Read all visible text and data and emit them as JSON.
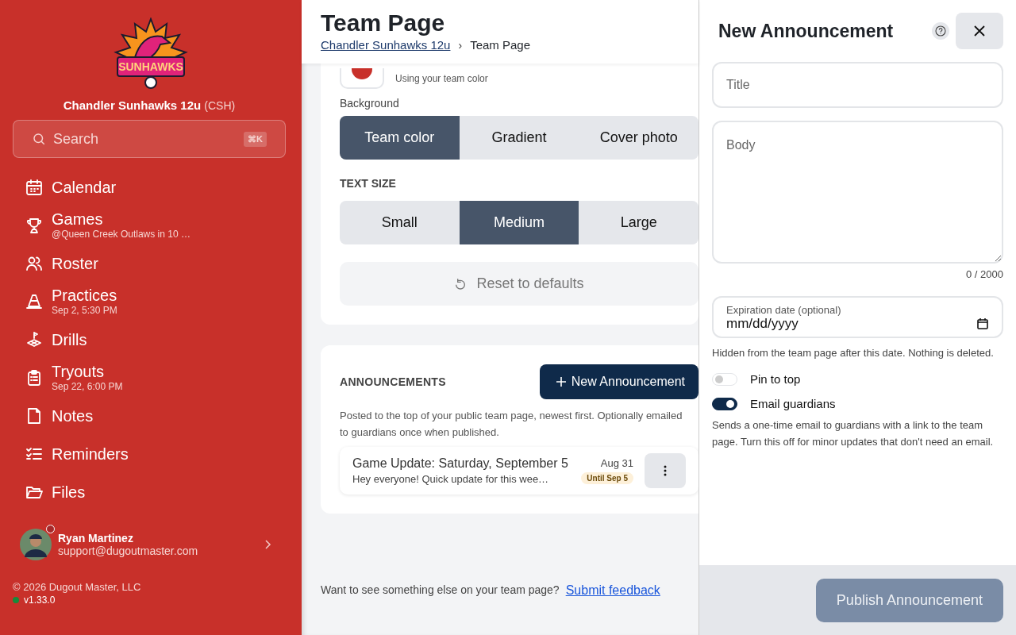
{
  "sidebar": {
    "logo": {
      "wordmark": "SUNHAWKS"
    },
    "team_name": "Chandler Sunhawks 12u",
    "team_code": "(CSH)",
    "search": {
      "placeholder": "Search",
      "shortcut": "⌘K"
    },
    "items": [
      {
        "label": "Calendar"
      },
      {
        "label": "Games",
        "sub": "@Queen Creek Outlaws in 10 …"
      },
      {
        "label": "Roster"
      },
      {
        "label": "Practices",
        "sub": "Sep 2, 5:30 PM"
      },
      {
        "label": "Drills"
      },
      {
        "label": "Tryouts",
        "sub": "Sep 22, 6:00 PM"
      },
      {
        "label": "Notes"
      },
      {
        "label": "Reminders"
      },
      {
        "label": "Files"
      }
    ],
    "user": {
      "name": "Ryan Martinez",
      "email": "support@dugoutmaster.com"
    },
    "copyright": "© 2026 Dugout Master, LLC",
    "version": "v1.33.0"
  },
  "header": {
    "title": "Team Page",
    "breadcrumb_separator": "›",
    "breadcrumb": [
      {
        "label": "Chandler Sunhawks 12u",
        "link": true
      },
      {
        "label": "Team Page",
        "link": false
      }
    ]
  },
  "appearance": {
    "swatch_text": "Using your team color",
    "background_label": "Background",
    "background_options": [
      {
        "label": "Team color",
        "selected": true
      },
      {
        "label": "Gradient",
        "selected": false
      },
      {
        "label": "Cover photo",
        "selected": false
      }
    ],
    "text_size_label": "TEXT SIZE",
    "text_size_options": [
      {
        "label": "Small",
        "selected": false
      },
      {
        "label": "Medium",
        "selected": true
      },
      {
        "label": "Large",
        "selected": false
      }
    ],
    "reset_button": "Reset to defaults"
  },
  "announcements": {
    "heading": "ANNOUNCEMENTS",
    "new_button": "New Announcement",
    "description": "Posted to the top of your public team page, newest first. Optionally emailed to guardians once when published.",
    "items": [
      {
        "title": "Game Update: Saturday, September 5",
        "excerpt": "Hey everyone! Quick update for this wee…",
        "date": "Aug 31",
        "badge": "Until Sep 5"
      }
    ]
  },
  "feedback": {
    "text": "Want to see something else on your team page?",
    "link": "Submit feedback"
  },
  "panel": {
    "title": "New Announcement",
    "title_field": {
      "placeholder": "Title"
    },
    "body_field": {
      "placeholder": "Body"
    },
    "counter": "0 / 2000",
    "expiration": {
      "label": "Expiration date (optional)",
      "value": "mm/dd/yyyy",
      "hint": "Hidden from the team page after this date. Nothing is deleted."
    },
    "toggles": [
      {
        "label": "Pin to top",
        "on": false
      },
      {
        "label": "Email guardians",
        "on": true,
        "hint": "Sends a one-time email to guardians with a link to the team page. Turn this off for minor updates that don't need an email."
      }
    ],
    "publish_button": "Publish Announcement",
    "publish_disabled": true
  }
}
